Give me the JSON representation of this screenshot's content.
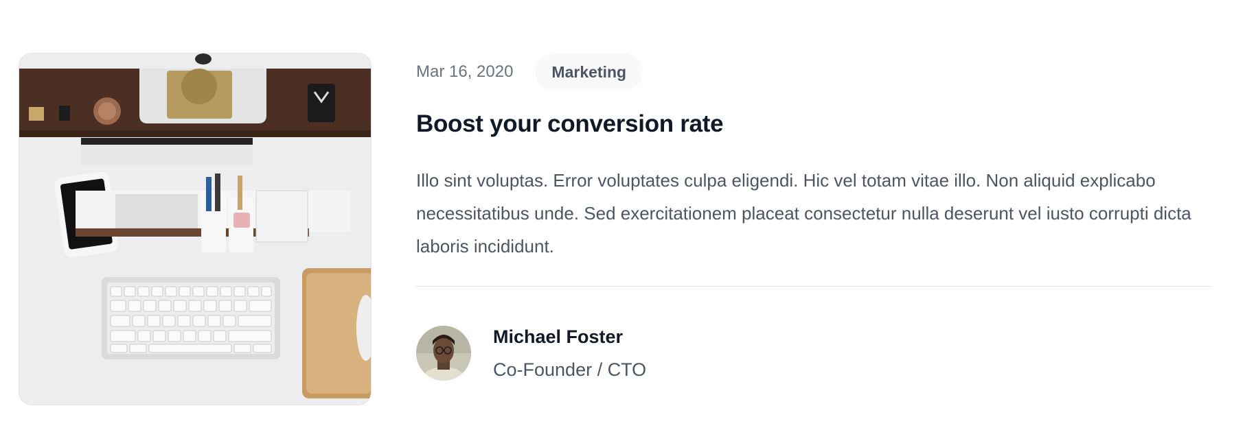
{
  "post": {
    "date": "Mar 16, 2020",
    "category": "Marketing",
    "title": "Boost your conversion rate",
    "excerpt": "Illo sint voluptas. Error voluptates culpa eligendi. Hic vel totam vitae illo. Non aliquid explicabo necessitatibus unde. Sed exercitationem placeat consectetur nulla deserunt vel iusto corrupti dicta laboris incididunt.",
    "image_subject": "desk-with-keyboard-phone-and-organizer"
  },
  "author": {
    "name": "Michael Foster",
    "role": "Co-Founder / CTO"
  },
  "colors": {
    "heading": "#111827",
    "body": "#4b5563",
    "muted": "#6b7280",
    "badge_bg": "#f8f9fb",
    "divider": "#e5e7eb"
  }
}
